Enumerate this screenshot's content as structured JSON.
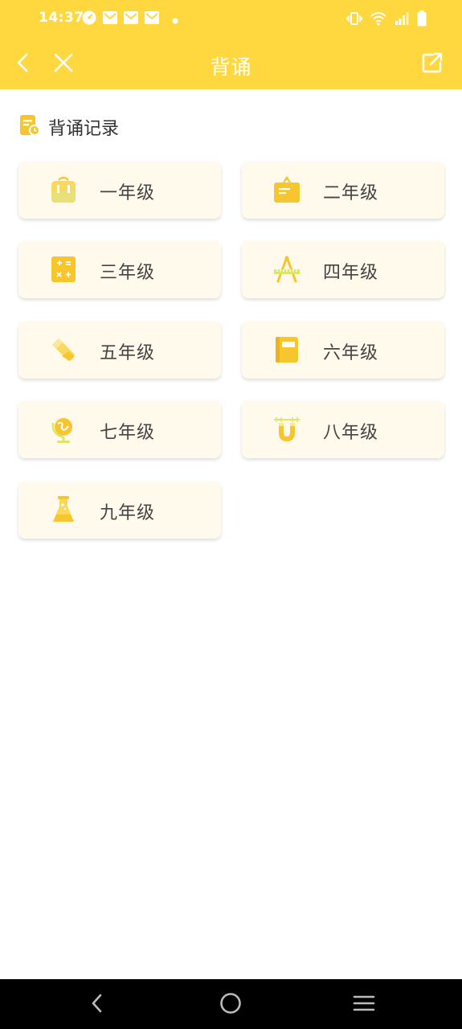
{
  "status_bar": {
    "time": "14:37",
    "left_icons": [
      "speedometer-icon",
      "mail-icon",
      "mail-icon",
      "mail-icon",
      "dot-icon"
    ],
    "right_icons": [
      "vibrate-icon",
      "wifi-icon",
      "signal-icon",
      "battery-icon"
    ]
  },
  "toolbar": {
    "title": "背诵",
    "background": "#FFD83F"
  },
  "section": {
    "label": "背诵记录",
    "icon": "record-icon"
  },
  "grades": [
    {
      "label": "一年级",
      "icon": "backpack-icon"
    },
    {
      "label": "二年级",
      "icon": "briefcase-icon"
    },
    {
      "label": "三年级",
      "icon": "calculator-icon"
    },
    {
      "label": "四年级",
      "icon": "ruler-compass-icon"
    },
    {
      "label": "五年级",
      "icon": "eraser-icon"
    },
    {
      "label": "六年级",
      "icon": "notebook-icon"
    },
    {
      "label": "七年级",
      "icon": "globe-icon"
    },
    {
      "label": "八年级",
      "icon": "magnet-icon"
    },
    {
      "label": "九年级",
      "icon": "flask-icon"
    }
  ],
  "colors": {
    "accent": "#FFD83F",
    "icon_yellow": "#F7C52D",
    "card_bg": "#FFFAEB",
    "text": "#444444"
  }
}
